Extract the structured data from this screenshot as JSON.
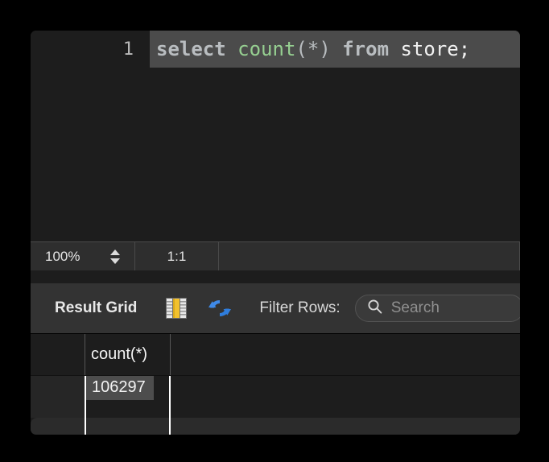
{
  "editor": {
    "line_number": "1",
    "query": "select count(*) from store;",
    "tokens": {
      "kw_select": "select",
      "fn_count": "count",
      "paren_open": "(",
      "star": "*",
      "paren_close": ")",
      "kw_from": "from",
      "table": "store",
      "semicolon": ";"
    }
  },
  "status_bar": {
    "zoom_level": "100%",
    "stepper_icon": "stepper-up-down-icon",
    "ratio": "1:1"
  },
  "result_toolbar": {
    "title": "Result Grid",
    "grid_columns_icon": "grid-columns-icon",
    "refresh_icon": "refresh-icon",
    "filter_label": "Filter Rows:",
    "search_icon": "search-icon",
    "search_value": "",
    "search_placeholder": "Search"
  },
  "results": {
    "columns": [
      "count(*)"
    ],
    "rows": [
      [
        "106297"
      ]
    ]
  },
  "colors": {
    "window_bg": "#1d1d1d",
    "toolbar_bg": "#333333",
    "status_bg": "#2e2e2e",
    "line_highlight": "#4b4b4b",
    "selection_bg": "#4d4d4d",
    "keyword": "#b9bdc0",
    "function": "#96cf91",
    "identifier": "#f2f2f2",
    "refresh_blue": "#3f8ae8",
    "grid_icon_gold": "#f2c12e"
  }
}
